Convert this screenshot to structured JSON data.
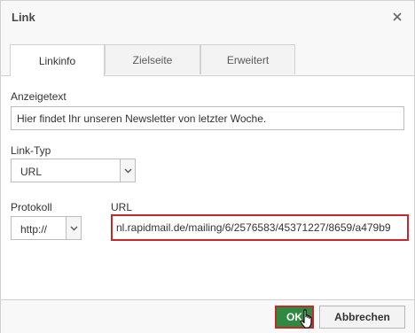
{
  "dialog": {
    "title": "Link",
    "close_icon": "close-icon"
  },
  "tabs": [
    {
      "label": "Linkinfo",
      "active": true
    },
    {
      "label": "Zielseite",
      "active": false
    },
    {
      "label": "Erweitert",
      "active": false
    }
  ],
  "form": {
    "display_text_label": "Anzeigetext",
    "display_text_value": "Hier findet Ihr unseren Newsletter von letzter Woche.",
    "link_type_label": "Link-Typ",
    "link_type_value": "URL",
    "protocol_label": "Protokoll",
    "protocol_value": "http://",
    "url_label": "URL",
    "url_value": "nl.rapidmail.de/mailing/6/2576583/45371227/8659/a479b9"
  },
  "footer": {
    "ok_label": "OK",
    "cancel_label": "Abbrechen"
  },
  "colors": {
    "ok_bg": "#2f8a41",
    "highlight_border": "#c8262b"
  }
}
